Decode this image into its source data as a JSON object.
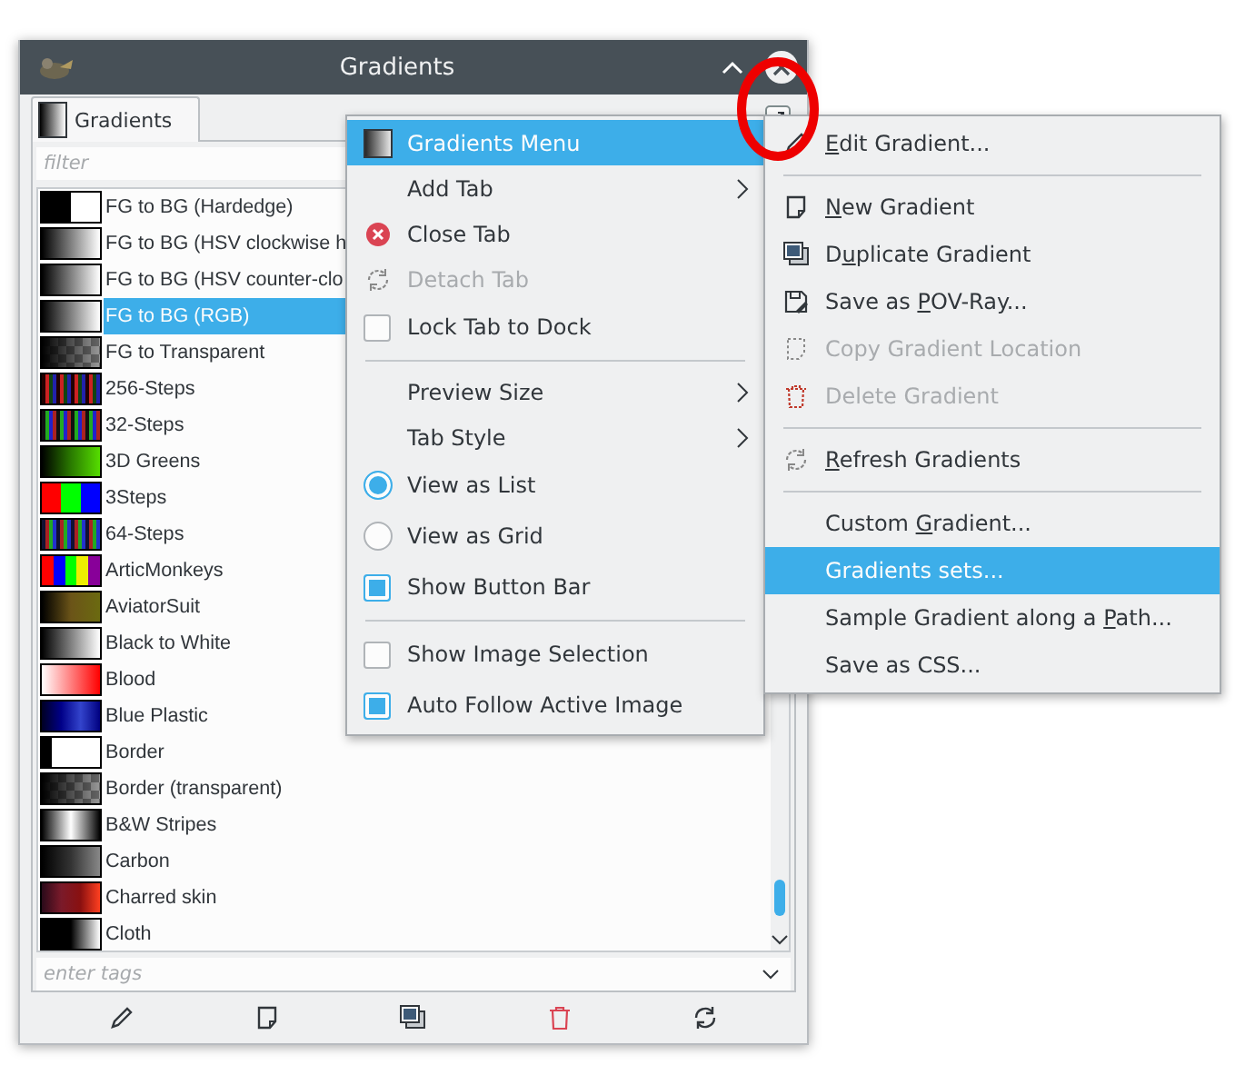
{
  "window": {
    "title": "Gradients"
  },
  "tabs": [
    {
      "label": "Gradients",
      "selected": true
    }
  ],
  "filter": {
    "placeholder": "filter"
  },
  "gradients": [
    {
      "label": "FG to BG (Hardedge)",
      "selected": false
    },
    {
      "label": "FG to BG (HSV clockwise h",
      "selected": false
    },
    {
      "label": "FG to BG (HSV counter-clo",
      "selected": false
    },
    {
      "label": "FG to BG (RGB)",
      "selected": true
    },
    {
      "label": "FG to Transparent",
      "selected": false
    },
    {
      "label": "256-Steps",
      "selected": false
    },
    {
      "label": "32-Steps",
      "selected": false
    },
    {
      "label": "3D Greens",
      "selected": false
    },
    {
      "label": "3Steps",
      "selected": false
    },
    {
      "label": "64-Steps",
      "selected": false
    },
    {
      "label": "ArticMonkeys",
      "selected": false
    },
    {
      "label": "AviatorSuit",
      "selected": false
    },
    {
      "label": "Black to White",
      "selected": false
    },
    {
      "label": "Blood",
      "selected": false
    },
    {
      "label": "Blue Plastic",
      "selected": false
    },
    {
      "label": "Border",
      "selected": false
    },
    {
      "label": "Border (transparent)",
      "selected": false
    },
    {
      "label": "B&W Stripes",
      "selected": false
    },
    {
      "label": "Carbon",
      "selected": false
    },
    {
      "label": "Charred skin",
      "selected": false
    },
    {
      "label": "Cloth",
      "selected": false
    }
  ],
  "tags": {
    "placeholder": "enter tags"
  },
  "dock_menu": [
    {
      "kind": "header",
      "label": "Gradients Menu",
      "selected": true
    },
    {
      "kind": "item",
      "label": "Add Tab",
      "submenu": true,
      "selected": false
    },
    {
      "kind": "item",
      "label": "Close Tab",
      "selected": false
    },
    {
      "kind": "item",
      "label": "Detach Tab",
      "disabled": true,
      "selected": false
    },
    {
      "kind": "check",
      "label": "Lock Tab to Dock",
      "checked": false,
      "selected": false
    },
    {
      "kind": "separator"
    },
    {
      "kind": "item",
      "label": "Preview Size",
      "submenu": true,
      "selected": false
    },
    {
      "kind": "item",
      "label": "Tab Style",
      "submenu": true,
      "selected": false
    },
    {
      "kind": "radio",
      "label": "View as List",
      "checked": true,
      "selected": false
    },
    {
      "kind": "radio",
      "label": "View as Grid",
      "checked": false,
      "selected": false
    },
    {
      "kind": "check",
      "label": "Show Button Bar",
      "checked": true,
      "selected": false
    },
    {
      "kind": "separator"
    },
    {
      "kind": "check",
      "label": "Show Image Selection",
      "checked": false,
      "selected": false
    },
    {
      "kind": "check",
      "label": "Auto Follow Active Image",
      "checked": true,
      "selected": false
    }
  ],
  "gradients_menu": [
    {
      "kind": "item",
      "label_parts": [
        {
          "text": "E",
          "underlined": true
        },
        {
          "text": "dit Gradient...",
          "underlined": false
        }
      ],
      "selected": false
    },
    {
      "kind": "separator"
    },
    {
      "kind": "item",
      "label_parts": [
        {
          "text": "N",
          "underlined": true
        },
        {
          "text": "ew Gradient",
          "underlined": false
        }
      ],
      "selected": false
    },
    {
      "kind": "item",
      "label_parts": [
        {
          "text": "D",
          "underlined": false
        },
        {
          "text": "u",
          "underlined": true
        },
        {
          "text": "plicate Gradient",
          "underlined": false
        }
      ],
      "selected": false
    },
    {
      "kind": "item",
      "label_parts": [
        {
          "text": "Save as ",
          "underlined": false
        },
        {
          "text": "P",
          "underlined": true
        },
        {
          "text": "OV-Ray...",
          "underlined": false
        }
      ],
      "selected": false
    },
    {
      "kind": "item",
      "label_parts": [
        {
          "text": "Copy Gradient Location",
          "underlined": false
        }
      ],
      "disabled": true,
      "selected": false
    },
    {
      "kind": "item",
      "label_parts": [
        {
          "text": "Delete Gradient",
          "underlined": false
        }
      ],
      "disabled": true,
      "selected": false
    },
    {
      "kind": "separator"
    },
    {
      "kind": "item",
      "label_parts": [
        {
          "text": "R",
          "underlined": true
        },
        {
          "text": "efresh Gradients",
          "underlined": false
        }
      ],
      "selected": false
    },
    {
      "kind": "separator"
    },
    {
      "kind": "item",
      "label_parts": [
        {
          "text": "Custom ",
          "underlined": false
        },
        {
          "text": "G",
          "underlined": true
        },
        {
          "text": "radient...",
          "underlined": false
        }
      ],
      "selected": false
    },
    {
      "kind": "item",
      "label_parts": [
        {
          "text": "Gradients sets...",
          "underlined": false
        }
      ],
      "selected": true
    },
    {
      "kind": "item",
      "label_parts": [
        {
          "text": "Sample Gradient along a ",
          "underlined": false
        },
        {
          "text": "P",
          "underlined": true
        },
        {
          "text": "ath...",
          "underlined": false
        }
      ],
      "selected": false
    },
    {
      "kind": "item",
      "label_parts": [
        {
          "text": "Save as CSS...",
          "underlined": false
        }
      ],
      "selected": false
    }
  ]
}
